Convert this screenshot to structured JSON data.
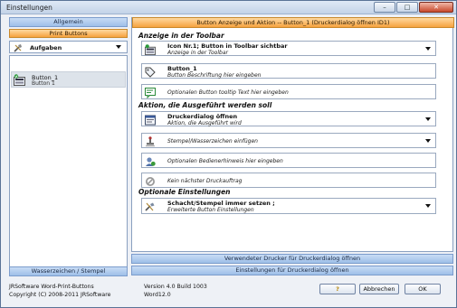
{
  "window": {
    "title": "Einstellungen"
  },
  "left": {
    "allgemein_label": "Allgemein",
    "print_buttons_label": "Print Buttons",
    "dropdown_value": "Aufgaben",
    "list_items": [
      {
        "name": "Button_1",
        "sub": "Button 1"
      }
    ],
    "wasserzeichen_label": "Wasserzeichen / Stempel"
  },
  "right": {
    "header": "Button Anzeige und Aktion  -- Button_1 (Druckerdialog öffnen ID1)",
    "sections": {
      "toolbar": "Anzeige in der Toolbar",
      "aktion": "Aktion, die Ausgeführt werden soll",
      "optionale": "Optionale Einstellungen"
    },
    "rows": {
      "icon": {
        "a": "Icon Nr.1; Button in Toolbar sichtbar",
        "b": "Anzeige in der Toolbar"
      },
      "beschriftung": {
        "a": "Button_1",
        "b": "Button Beschriftung hier eingeben"
      },
      "tooltip": {
        "single": "Optionalen Button tooltip Text hier eingeben"
      },
      "druckerdialog": {
        "a": "Druckerdialog öffnen",
        "b": "Aktion, die Ausgeführt wird"
      },
      "stempel": {
        "single": "Stempel/Wasserzeichen einfügen"
      },
      "bediener": {
        "single": "Optionalen Bedienerhinweis hier eingeben"
      },
      "druckauftrag": {
        "single": "Kein nächster Druckauftrag"
      },
      "schacht": {
        "a": "Schacht/Stempel immer setzen ;",
        "b": "Erweiterte Button Einstellungen"
      }
    },
    "verwendeter_drucker": "Verwendeter Drucker für Druckerdialog öffnen",
    "einstellungen_drucker": "Einstellungen für Druckerdialog öffnen"
  },
  "footer": {
    "app_name": "JRSoftware Word-Print-Buttons",
    "copyright": "Copyright (C) 2008-2011 JRSoftware",
    "version": "Version 4.0 Build 1003",
    "word": "Word12.0",
    "help_glyph": "?",
    "abbrechen": "Abbrechen",
    "ok": "OK"
  },
  "colors": {
    "orange_accent": "#f6a23e",
    "blue_accent": "#9ebfe8",
    "close_red": "#c8472a"
  },
  "icons": [
    "minimize-icon",
    "maximize-icon",
    "close-icon",
    "tools-icon",
    "caret-down-icon",
    "button-icon",
    "tag-icon",
    "tooltip-icon",
    "print-icon",
    "stamp-icon",
    "user-icon",
    "no-entry-icon",
    "tray-icon",
    "help-icon"
  ]
}
